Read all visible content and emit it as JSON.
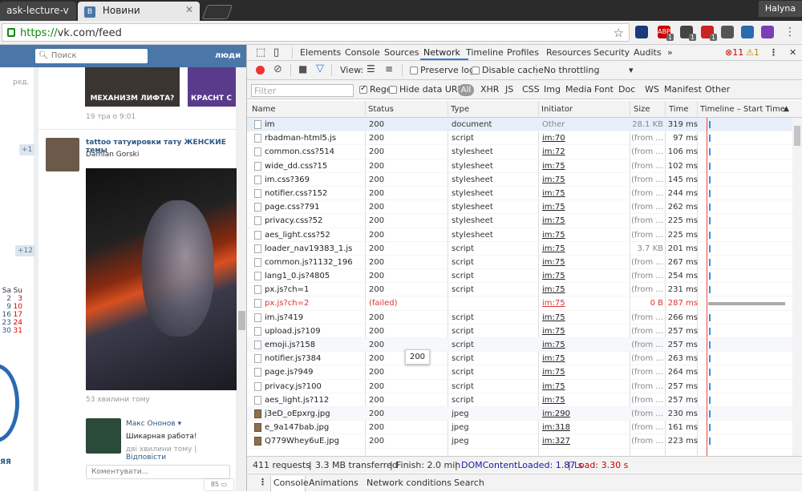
{
  "browser": {
    "tabs": [
      {
        "label": "ask-lecture-v"
      },
      {
        "label": "Новини",
        "favicon": "В"
      }
    ],
    "user": "Halyna",
    "url_scheme": "https://",
    "url_rest": "vk.com/feed",
    "extensions": [
      {
        "name": "ext-1",
        "badge": "",
        "color": "#1a3a7a"
      },
      {
        "name": "abp",
        "label": "ABP",
        "badge": "1",
        "color": "#c00"
      },
      {
        "name": "ext-3",
        "badge": "1",
        "color": "#444"
      },
      {
        "name": "ext-4",
        "badge": "1",
        "color": "#c22"
      },
      {
        "name": "ext-5",
        "badge": "",
        "color": "#555"
      },
      {
        "name": "ext-6",
        "badge": "",
        "color": "#2a6ab0"
      },
      {
        "name": "ext-7",
        "badge": "",
        "color": "#7b3fb5"
      }
    ]
  },
  "vk": {
    "search_placeholder": "Поиск",
    "people": "люди",
    "left_red": "ред.",
    "plus1": "+1",
    "plus12": "+12",
    "cal_head": [
      "Sa",
      "Su"
    ],
    "cal_rows": [
      [
        "2",
        "3"
      ],
      [
        "9",
        "10"
      ],
      [
        "16",
        "17"
      ],
      [
        "23",
        "24"
      ],
      [
        "30",
        "31"
      ]
    ],
    "left_yellow": "ЯЯ",
    "thumb1": "МЕХАНИЗМ ЛИФТА?",
    "thumb2": "КРАСНТ С",
    "post1_date": "19 тра о 9:01",
    "post2_title": "tattoo татуировки тату ЖЕНСКИЕ темы",
    "post2_author": "Damian Gorski",
    "post2_time": "53 хвилини тому",
    "comment_author": "Макс Ононов",
    "comment_text": "Шикарная работа!",
    "comment_time": "дві хвилини тому",
    "comment_reply": "Відповісти",
    "comment_input": "Коментувати...",
    "comment_count": "85"
  },
  "devtools": {
    "tabs": [
      "Elements",
      "Console",
      "Sources",
      "Network",
      "Timeline",
      "Profiles",
      "Resources",
      "Security",
      "Audits"
    ],
    "errors": "11",
    "warnings": "1",
    "view_label": "View:",
    "preserve_log": "Preserve log",
    "disable_cache": "Disable cache",
    "throttling": "No throttling",
    "filter_placeholder": "Filter",
    "regex": "Regex",
    "hide_data_urls": "Hide data URLs",
    "types": [
      "All",
      "XHR",
      "JS",
      "CSS",
      "Img",
      "Media",
      "Font",
      "Doc",
      "WS",
      "Manifest",
      "Other"
    ],
    "columns": [
      "Name",
      "Status",
      "Type",
      "Initiator",
      "Size",
      "Time",
      "Timeline – Start Time"
    ],
    "rows": [
      {
        "name": "im",
        "status": "200",
        "type": "document",
        "initiator": "Other",
        "size": "28.1 KB",
        "time": "319 ms"
      },
      {
        "name": "rbadman-html5.js",
        "status": "200",
        "type": "script",
        "initiator": "im:70",
        "size": "(from ...",
        "time": "97 ms"
      },
      {
        "name": "common.css?514",
        "status": "200",
        "type": "stylesheet",
        "initiator": "im:72",
        "size": "(from ...",
        "time": "106 ms"
      },
      {
        "name": "wide_dd.css?15",
        "status": "200",
        "type": "stylesheet",
        "initiator": "im:75",
        "size": "(from ...",
        "time": "102 ms"
      },
      {
        "name": "im.css?369",
        "status": "200",
        "type": "stylesheet",
        "initiator": "im:75",
        "size": "(from ...",
        "time": "145 ms"
      },
      {
        "name": "notifier.css?152",
        "status": "200",
        "type": "stylesheet",
        "initiator": "im:75",
        "size": "(from ...",
        "time": "244 ms"
      },
      {
        "name": "page.css?791",
        "status": "200",
        "type": "stylesheet",
        "initiator": "im:75",
        "size": "(from ...",
        "time": "262 ms"
      },
      {
        "name": "privacy.css?52",
        "status": "200",
        "type": "stylesheet",
        "initiator": "im:75",
        "size": "(from ...",
        "time": "225 ms"
      },
      {
        "name": "aes_light.css?52",
        "status": "200",
        "type": "stylesheet",
        "initiator": "im:75",
        "size": "(from ...",
        "time": "225 ms"
      },
      {
        "name": "loader_nav19383_1.js",
        "status": "200",
        "type": "script",
        "initiator": "im:75",
        "size": "3.7 KB",
        "time": "201 ms"
      },
      {
        "name": "common.js?1132_196",
        "status": "200",
        "type": "script",
        "initiator": "im:75",
        "size": "(from ...",
        "time": "267 ms"
      },
      {
        "name": "lang1_0.js?4805",
        "status": "200",
        "type": "script",
        "initiator": "im:75",
        "size": "(from ...",
        "time": "254 ms"
      },
      {
        "name": "px.js?ch=1",
        "status": "200",
        "type": "script",
        "initiator": "im:75",
        "size": "(from ...",
        "time": "231 ms"
      },
      {
        "name": "px.js?ch=2",
        "status": "(failed)",
        "type": "",
        "initiator": "im:75",
        "size": "0 B",
        "time": "287 ms",
        "failed": true
      },
      {
        "name": "im.js?419",
        "status": "200",
        "type": "script",
        "initiator": "im:75",
        "size": "(from ...",
        "time": "266 ms"
      },
      {
        "name": "upload.js?109",
        "status": "200",
        "type": "script",
        "initiator": "im:75",
        "size": "(from ...",
        "time": "257 ms"
      },
      {
        "name": "emoji.js?158",
        "status": "200",
        "type": "script",
        "initiator": "im:75",
        "size": "(from ...",
        "time": "257 ms"
      },
      {
        "name": "notifier.js?384",
        "status": "200",
        "type": "script",
        "initiator": "im:75",
        "size": "(from ...",
        "time": "263 ms"
      },
      {
        "name": "page.js?949",
        "status": "200",
        "type": "script",
        "initiator": "im:75",
        "size": "(from ...",
        "time": "264 ms"
      },
      {
        "name": "privacy.js?100",
        "status": "200",
        "type": "script",
        "initiator": "im:75",
        "size": "(from ...",
        "time": "257 ms"
      },
      {
        "name": "aes_light.js?112",
        "status": "200",
        "type": "script",
        "initiator": "im:75",
        "size": "(from ...",
        "time": "257 ms"
      },
      {
        "name": "j3eD_oEpxrg.jpg",
        "status": "200",
        "type": "jpeg",
        "initiator": "im:290",
        "size": "(from ...",
        "time": "230 ms",
        "img": true
      },
      {
        "name": "e_9a147bab.jpg",
        "status": "200",
        "type": "jpeg",
        "initiator": "im:318",
        "size": "(from ...",
        "time": "161 ms",
        "img": true
      },
      {
        "name": "Q779Whey6uE.jpg",
        "status": "200",
        "type": "jpeg",
        "initiator": "im:327",
        "size": "(from ...",
        "time": "223 ms",
        "img": true
      }
    ],
    "tooltip": "200",
    "status_bar": {
      "requests": "411 requests",
      "transferred": "3.3 MB transferred",
      "finish": "Finish: 2.0 min",
      "dcl": "DOMContentLoaded: 1.87 s",
      "load": "Load: 3.30 s"
    },
    "drawer_tabs": [
      "Console",
      "Animations",
      "Network conditions",
      "Search"
    ]
  }
}
